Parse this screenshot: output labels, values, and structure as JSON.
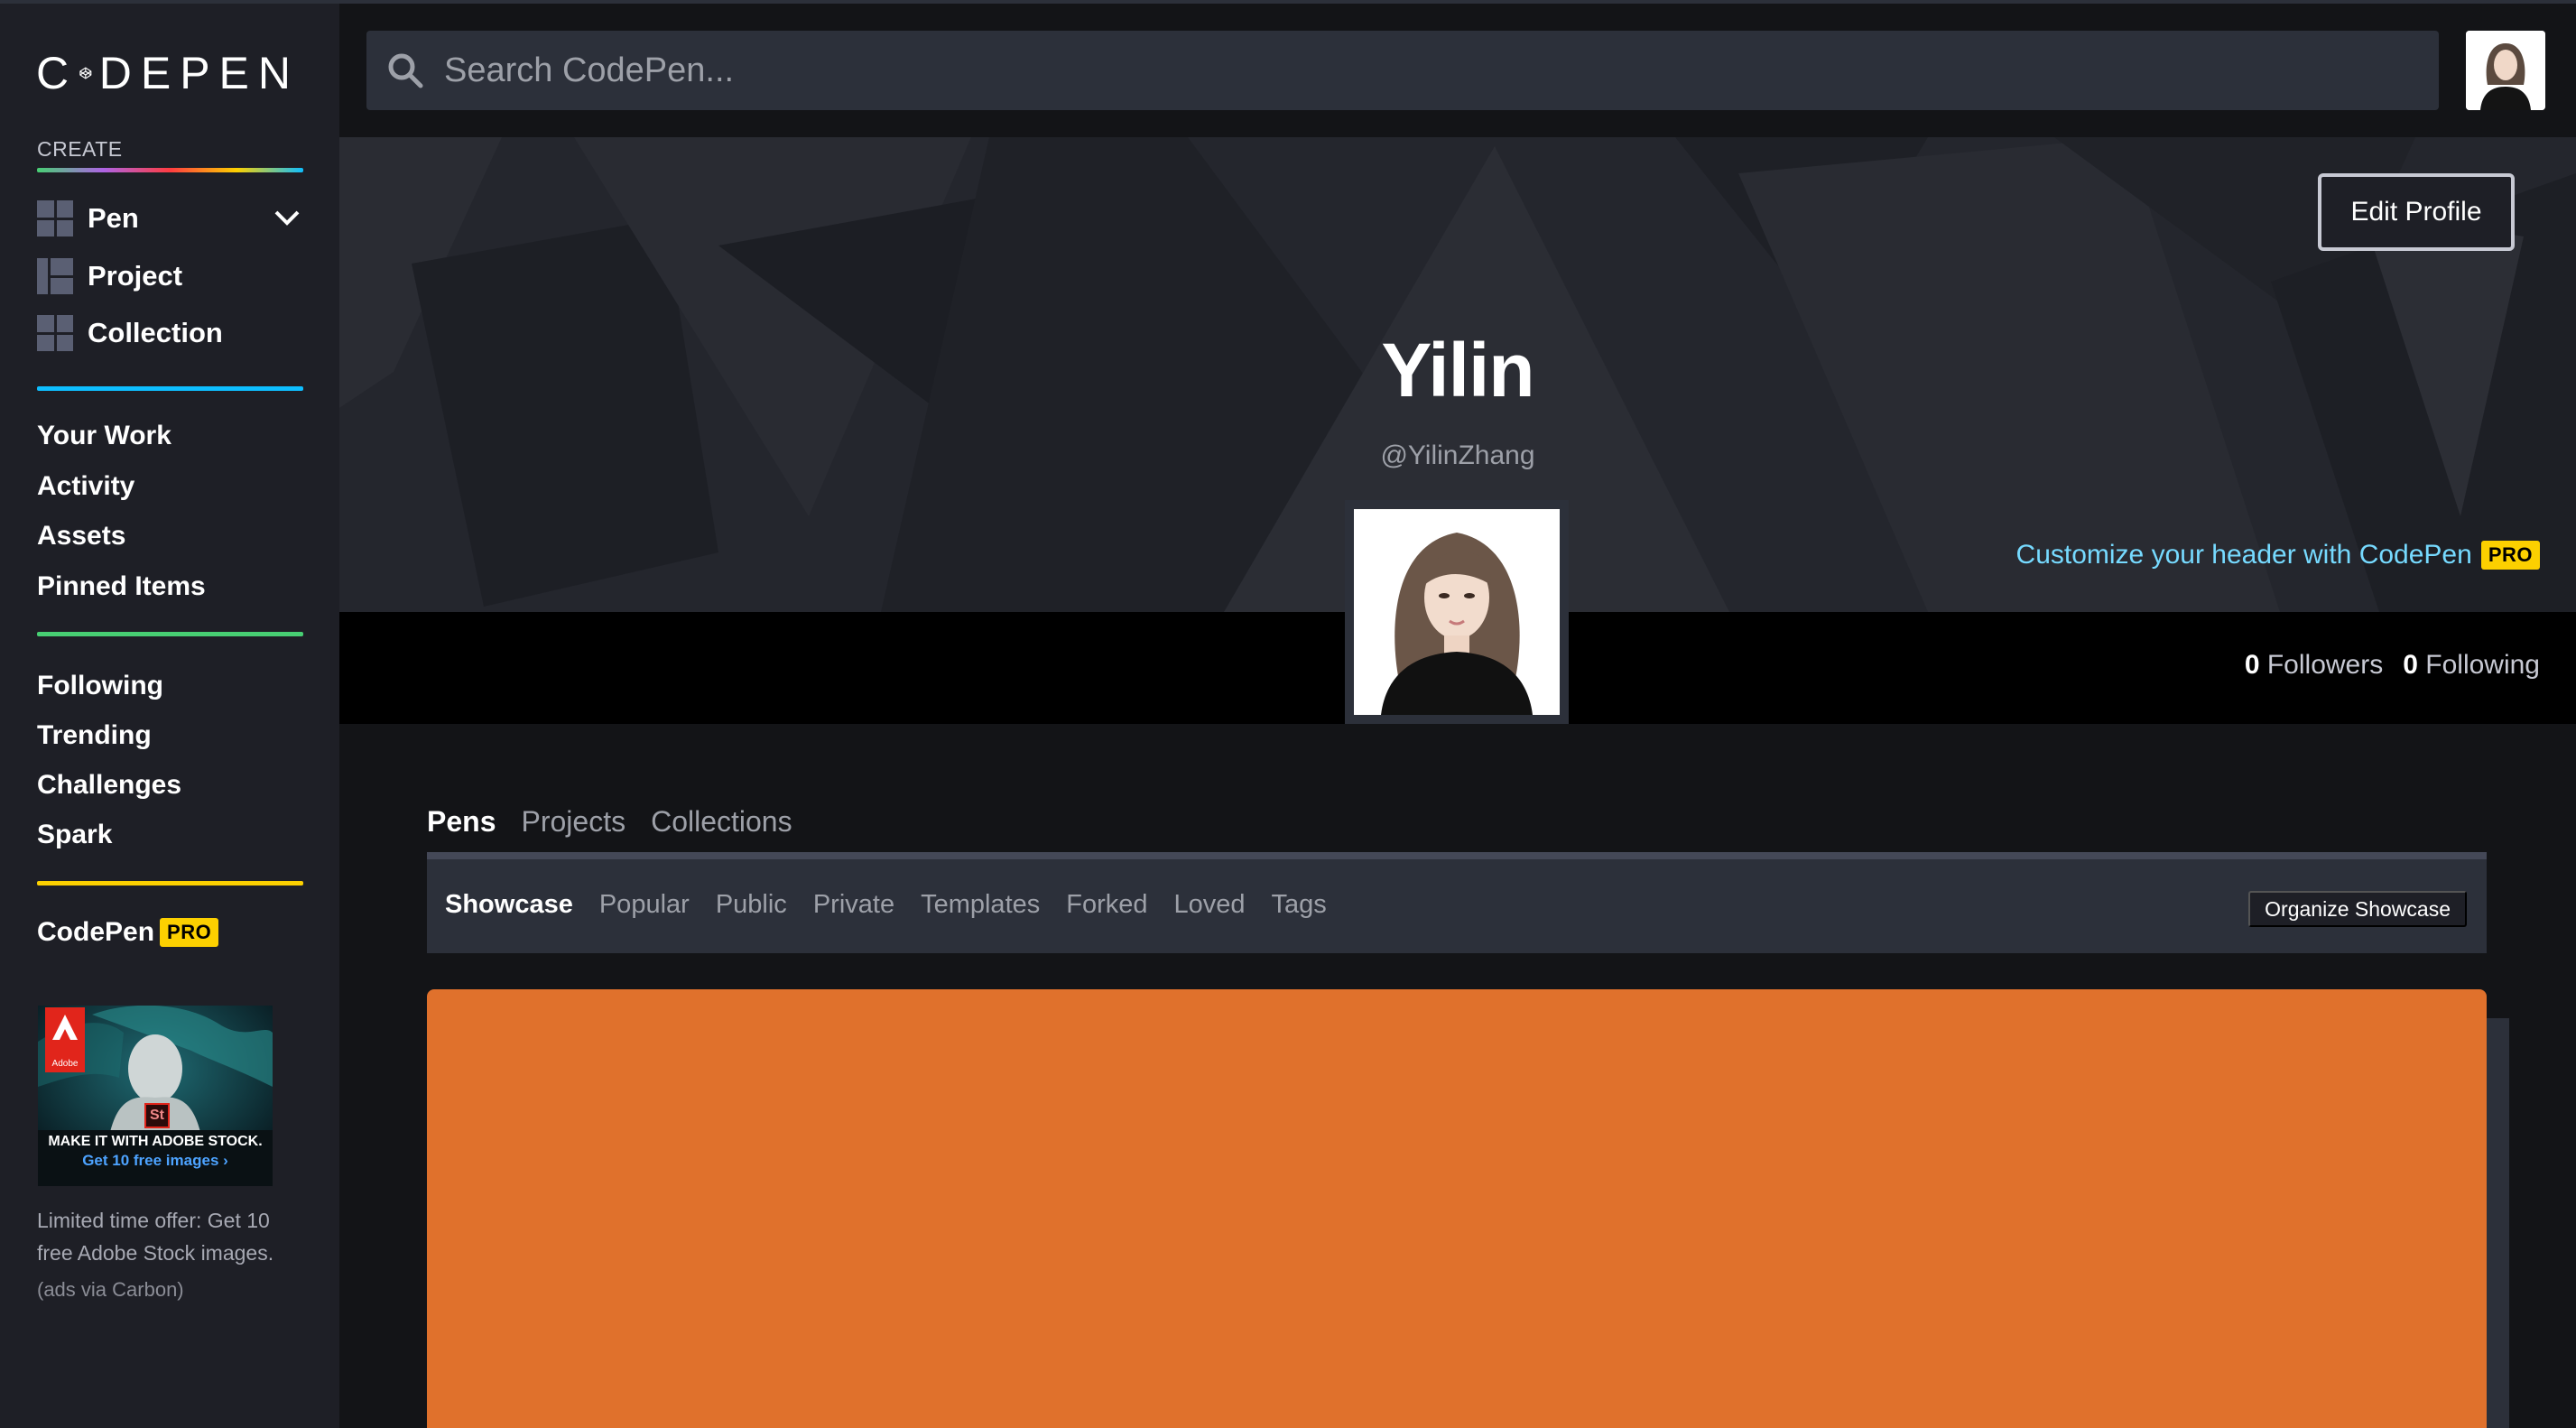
{
  "brand": {
    "logo_text_left": "C",
    "logo_text_right": "DEPEN"
  },
  "sidebar": {
    "create_label": "CREATE",
    "create_items": [
      {
        "label": "Pen",
        "icon": "pen-icon"
      },
      {
        "label": "Project",
        "icon": "project-icon"
      },
      {
        "label": "Collection",
        "icon": "collection-icon"
      }
    ],
    "nav_group_1": [
      "Your Work",
      "Activity",
      "Assets",
      "Pinned Items"
    ],
    "nav_group_2": [
      "Following",
      "Trending",
      "Challenges",
      "Spark"
    ],
    "pro_link": {
      "label": "CodePen",
      "badge": "PRO"
    },
    "ad": {
      "headline": "MAKE IT WITH ADOBE STOCK.",
      "cta": "Get 10 free images ›",
      "brand": "Adobe",
      "st_badge": "St",
      "description": "Limited time offer: Get 10 free Adobe Stock images.",
      "via": "(ads via Carbon)"
    }
  },
  "search": {
    "placeholder": "Search CodePen..."
  },
  "profile": {
    "name": "Yilin",
    "handle": "@YilinZhang",
    "edit_button": "Edit Profile",
    "customize_text": "Customize your header with CodePen",
    "customize_badge": "PRO",
    "followers_count": "0",
    "followers_label": "Followers",
    "following_count": "0",
    "following_label": "Following"
  },
  "tabs": [
    "Pens",
    "Projects",
    "Collections"
  ],
  "subtabs": [
    "Showcase",
    "Popular",
    "Public",
    "Private",
    "Templates",
    "Forked",
    "Loved",
    "Tags"
  ],
  "organize_button": "Organize Showcase",
  "colors": {
    "sidebar_bg": "#1e1f26",
    "page_bg": "#131417",
    "pro_yellow": "#fcd000",
    "accent_blue": "#0ebeff",
    "accent_green": "#47cf73",
    "card_orange": "#e0712c",
    "link_cyan": "#76daff"
  }
}
